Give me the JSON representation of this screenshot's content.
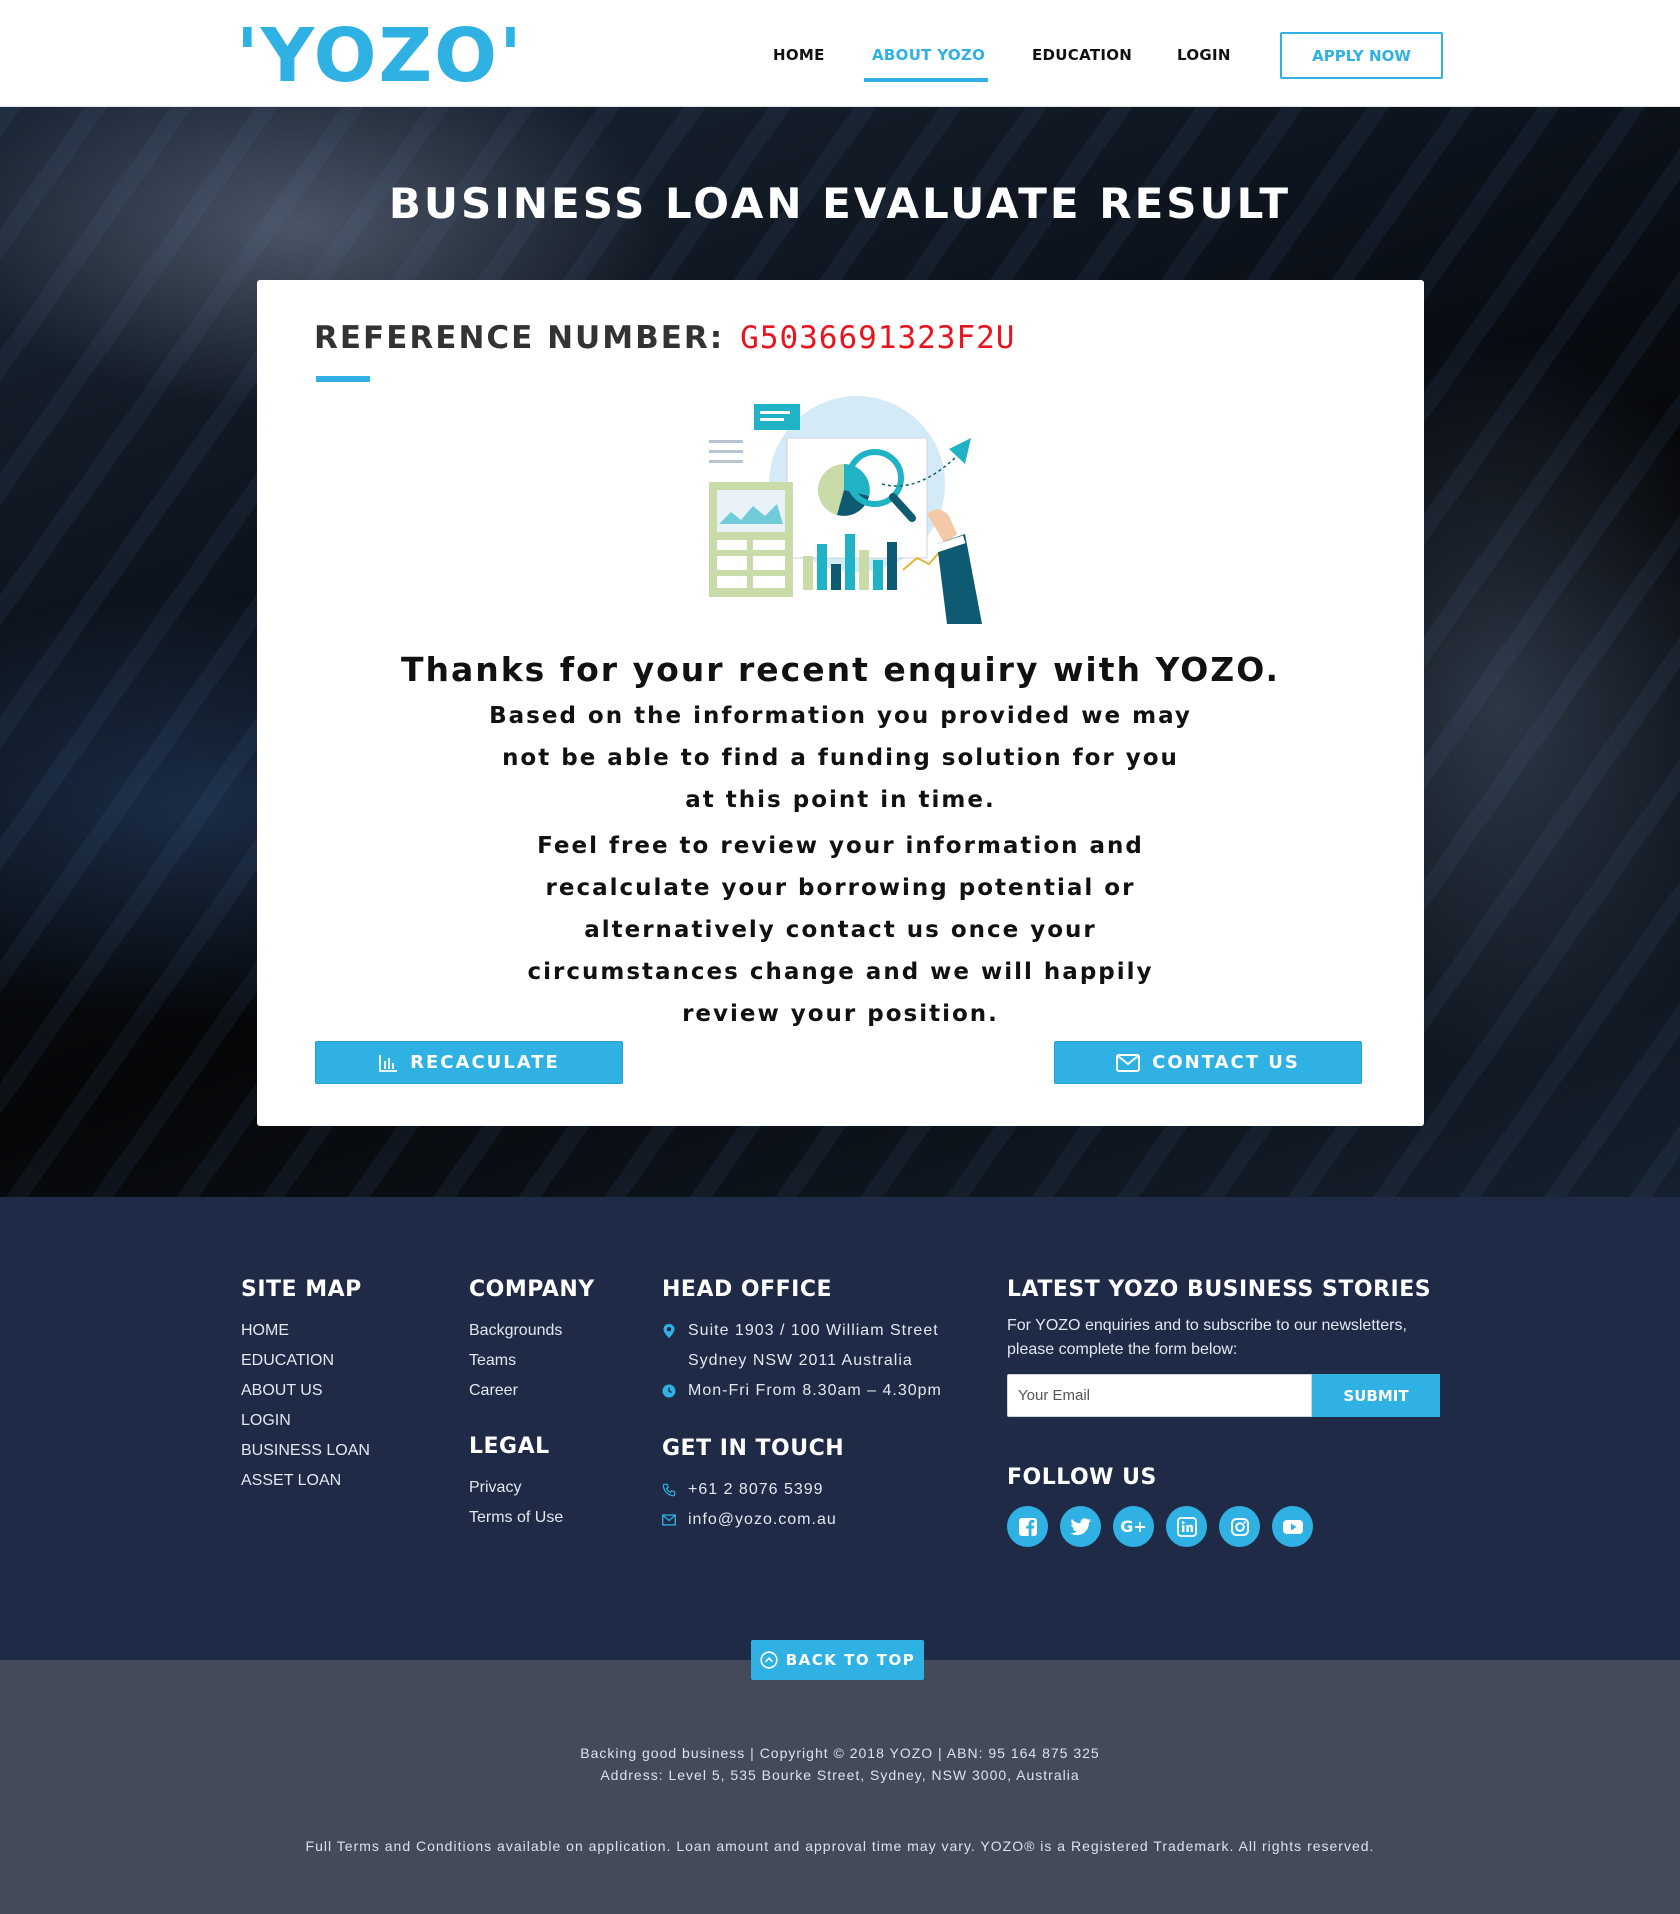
{
  "header": {
    "logo": "'YOZO'",
    "nav": {
      "home": "HOME",
      "about": "ABOUT YOZO",
      "education": "EDUCATION",
      "login": "LOGIN"
    },
    "apply_label": "APPLY NOW"
  },
  "hero": {
    "title": "BUSINESS LOAN EVALUATE RESULT"
  },
  "result": {
    "reference_label": "REFERENCE NUMBER:",
    "reference_number": "G5036691323F2U",
    "thanks": "Thanks for your recent enquiry with YOZO.",
    "message_1": "Based on the information you provided we may not be able to find a funding solution for you at this point in time.",
    "message_2": "Feel free to review your information and recalculate your borrowing potential or alternatively contact us once your circumstances change and we will happily review your position.",
    "recalc_label": "RECACULATE",
    "contact_label": "CONTACT US"
  },
  "footer": {
    "sitemap": {
      "heading": "SITE MAP",
      "links": [
        "HOME",
        "EDUCATION",
        "ABOUT US",
        "LOGIN",
        "BUSINESS LOAN",
        "ASSET LOAN"
      ]
    },
    "company": {
      "heading": "COMPANY",
      "links": [
        "Backgrounds",
        "Teams",
        "Career"
      ]
    },
    "legal": {
      "heading": "LEGAL",
      "links": [
        "Privacy",
        "Terms of Use"
      ]
    },
    "head_office": {
      "heading": "HEAD OFFICE",
      "address_1": "Suite 1903 / 100 William Street",
      "address_2": "Sydney NSW 2011 Australia",
      "hours": "Mon-Fri From 8.30am – 4.30pm"
    },
    "contact": {
      "heading": "GET IN TOUCH",
      "phone": "+61 2 8076 5399",
      "email": "info@yozo.com.au"
    },
    "stories": {
      "heading": "LATEST YOZO BUSINESS STORIES",
      "text": "For YOZO enquiries and to subscribe to our newsletters, please complete the form below:",
      "email_placeholder": "Your Email",
      "submit_label": "SUBMIT"
    },
    "follow": {
      "heading": "FOLLOW US",
      "icons": [
        "facebook-icon",
        "twitter-icon",
        "google-plus-icon",
        "linkedin-icon",
        "instagram-icon",
        "youtube-icon"
      ]
    },
    "back_to_top": "BACK TO TOP"
  },
  "bottom": {
    "copyright": "Backing good business | Copyright © 2018 YOZO | ABN: 95 164 875 325",
    "address": "Address: Level 5, 535 Bourke Street, Sydney, NSW 3000, Australia",
    "terms": "Full Terms and Conditions available on application. Loan amount and approval time may vary. YOZO® is a Registered Trademark. All rights reserved."
  },
  "colors": {
    "accent": "#2fb1e4",
    "reference": "#e8151f",
    "footer_bg": "#1f2a47",
    "bottom_bg": "#444a5a"
  }
}
